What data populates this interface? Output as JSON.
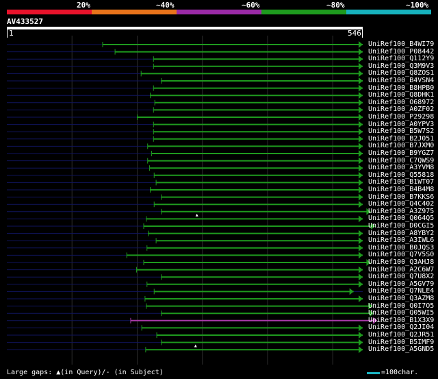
{
  "legend": {
    "labels": [
      "20%",
      "~40%",
      "~60%",
      "~80%",
      "~100%"
    ],
    "colors": [
      "#e8132b",
      "#e8731b",
      "#9a2aa6",
      "#1e9a1e",
      "#17b2bd"
    ]
  },
  "query": {
    "name": "AV433527",
    "start": "1",
    "end": "546",
    "length": 546
  },
  "hits": [
    {
      "name": "UniRef100_B4WI79",
      "start": 147,
      "end": 546,
      "color": "#1e9a1e"
    },
    {
      "name": "UniRef100_P08442",
      "start": 166,
      "end": 546,
      "color": "#1e9a1e"
    },
    {
      "name": "UniRef100_Q112Y9",
      "start": 225,
      "end": 546,
      "color": "#1e9a1e"
    },
    {
      "name": "UniRef100_Q3M9V3",
      "start": 225,
      "end": 546,
      "color": "#1e9a1e"
    },
    {
      "name": "UniRef100_Q8ZOS1",
      "start": 206,
      "end": 546,
      "color": "#1e9a1e"
    },
    {
      "name": "UniRef100_B4VSN4",
      "start": 237,
      "end": 546,
      "color": "#1e9a1e"
    },
    {
      "name": "UniRef100_B8HPB0",
      "start": 225,
      "end": 546,
      "color": "#1e9a1e"
    },
    {
      "name": "UniRef100_Q8DHK1",
      "start": 220,
      "end": 546,
      "color": "#1e9a1e"
    },
    {
      "name": "UniRef100_O68972",
      "start": 227,
      "end": 546,
      "color": "#1e9a1e"
    },
    {
      "name": "UniRef100_A0ZF02",
      "start": 225,
      "end": 546,
      "color": "#1e9a1e"
    },
    {
      "name": "UniRef100_P29298",
      "start": 200,
      "end": 546,
      "color": "#1e9a1e"
    },
    {
      "name": "UniRef100_A0YPV3",
      "start": 225,
      "end": 546,
      "color": "#1e9a1e"
    },
    {
      "name": "UniRef100_B5W7S2",
      "start": 225,
      "end": 546,
      "color": "#1e9a1e"
    },
    {
      "name": "UniRef100_B2J051",
      "start": 225,
      "end": 546,
      "color": "#1e9a1e"
    },
    {
      "name": "UniRef100_B7JXM0",
      "start": 216,
      "end": 546,
      "color": "#1e9a1e"
    },
    {
      "name": "UniRef100_B9YGZ7",
      "start": 222,
      "end": 546,
      "color": "#1e9a1e"
    },
    {
      "name": "UniRef100_C7QWS9",
      "start": 216,
      "end": 546,
      "color": "#1e9a1e"
    },
    {
      "name": "UniRef100_A3YVM8",
      "start": 219,
      "end": 546,
      "color": "#1e9a1e"
    },
    {
      "name": "UniRef100_Q55818",
      "start": 226,
      "end": 546,
      "color": "#1e9a1e"
    },
    {
      "name": "UniRef100_B1WT07",
      "start": 229,
      "end": 546,
      "color": "#1e9a1e"
    },
    {
      "name": "UniRef100_B4B4M8",
      "start": 220,
      "end": 546,
      "color": "#1e9a1e"
    },
    {
      "name": "UniRef100_B7KKS6",
      "start": 237,
      "end": 546,
      "color": "#1e9a1e"
    },
    {
      "name": "UniRef100_Q4C402",
      "start": 226,
      "end": 546,
      "color": "#1e9a1e"
    },
    {
      "name": "UniRef100_A3Z975",
      "start": 237,
      "end": 558,
      "color": "#1e9a1e",
      "gap": true
    },
    {
      "name": "UniRef100_Q064Q5",
      "start": 214,
      "end": 546,
      "color": "#1e9a1e"
    },
    {
      "name": "UniRef100_D0CGI5",
      "start": 210,
      "end": 565,
      "color": "#1e9a1e"
    },
    {
      "name": "UniRef100_A8YBY2",
      "start": 217,
      "end": 546,
      "color": "#1e9a1e"
    },
    {
      "name": "UniRef100_A3IWL6",
      "start": 229,
      "end": 546,
      "color": "#1e9a1e"
    },
    {
      "name": "UniRef100_B0JQS3",
      "start": 215,
      "end": 546,
      "color": "#1e9a1e"
    },
    {
      "name": "UniRef100_Q7V5S0",
      "start": 184,
      "end": 546,
      "color": "#1e9a1e"
    },
    {
      "name": "UniRef100_Q3AHJ8",
      "start": 210,
      "end": 558,
      "color": "#1e9a1e"
    },
    {
      "name": "UniRef100_A2C6W7",
      "start": 199,
      "end": 546,
      "color": "#1e9a1e"
    },
    {
      "name": "UniRef100_Q7U8X2",
      "start": 237,
      "end": 546,
      "color": "#1e9a1e"
    },
    {
      "name": "UniRef100_A5GV79",
      "start": 215,
      "end": 546,
      "color": "#1e9a1e"
    },
    {
      "name": "UniRef100_Q7NLE4",
      "start": 226,
      "end": 532,
      "color": "#1e9a1e"
    },
    {
      "name": "UniRef100_Q3AZM8",
      "start": 212,
      "end": 546,
      "color": "#1e9a1e"
    },
    {
      "name": "UniRef100_Q0I7O5",
      "start": 214,
      "end": 561,
      "color": "#1e9a1e"
    },
    {
      "name": "UniRef100_Q05WI5",
      "start": 237,
      "end": 563,
      "color": "#1e9a1e"
    },
    {
      "name": "UniRef100_B1X3X9",
      "start": 190,
      "end": 568,
      "color": "#a83aa8"
    },
    {
      "name": "UniRef100_Q2JI04",
      "start": 207,
      "end": 546,
      "color": "#1e9a1e"
    },
    {
      "name": "UniRef100_Q2JR51",
      "start": 230,
      "end": 546,
      "color": "#1e9a1e"
    },
    {
      "name": "UniRef100_B5IMF9",
      "start": 237,
      "end": 546,
      "color": "#1e9a1e",
      "gap": true
    },
    {
      "name": "UniRef100_A5GND5",
      "start": 213,
      "end": 546,
      "color": "#1e9a1e"
    }
  ],
  "footer": {
    "gaps_prefix": "Large gaps: ",
    "gaps_query": "(in Query)/",
    "gaps_dash": "-",
    "gaps_subject": " (in Subject)",
    "scale_label": "=100char.",
    "scale_color": "#1bb6c4"
  }
}
